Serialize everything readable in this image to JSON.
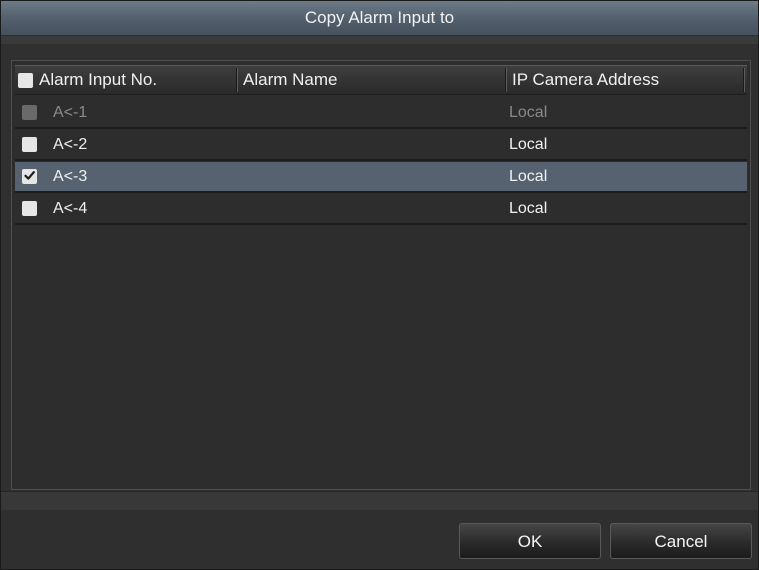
{
  "dialog": {
    "title": "Copy Alarm Input to"
  },
  "table": {
    "columns": [
      "Alarm Input No.",
      "Alarm Name",
      "IP Camera Address"
    ],
    "select_all_checked": false,
    "rows": [
      {
        "no": "A<-1",
        "name": "",
        "address": "Local",
        "checked": false,
        "disabled": true,
        "selected": false
      },
      {
        "no": "A<-2",
        "name": "",
        "address": "Local",
        "checked": false,
        "disabled": false,
        "selected": false
      },
      {
        "no": "A<-3",
        "name": "",
        "address": "Local",
        "checked": true,
        "disabled": false,
        "selected": true
      },
      {
        "no": "A<-4",
        "name": "",
        "address": "Local",
        "checked": false,
        "disabled": false,
        "selected": false
      }
    ]
  },
  "buttons": {
    "ok_label": "OK",
    "cancel_label": "Cancel"
  },
  "colors": {
    "title_bar": "#55626f",
    "selected_row": "#566270",
    "background": "#303030",
    "text": "#f0f0f0",
    "disabled_text": "#8a8a8a"
  },
  "icons": {
    "checkbox_checked": "check-mark"
  }
}
